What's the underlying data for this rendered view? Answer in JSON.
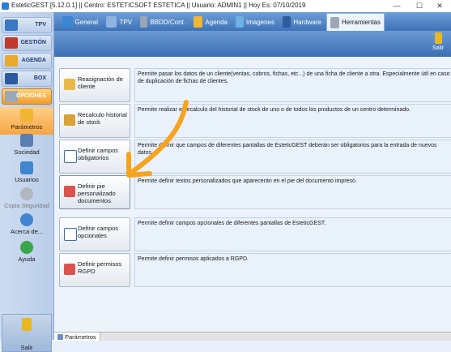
{
  "window": {
    "title": "EsteticGEST [5.12.0.1] || Centro: ESTETICSOFT ESTETICA || Usuario: ADMIN1 || Hoy Es: 07/10/2019",
    "minimize": "—",
    "maximize": "☐",
    "close": "✕"
  },
  "tabs": [
    {
      "label": "General",
      "icon": "general-icon",
      "color": "#3a86d1"
    },
    {
      "label": "TPV",
      "icon": "tpv-icon",
      "color": "#5a8fd0"
    },
    {
      "label": "BBDD/Cont.",
      "icon": "database-icon",
      "color": "#7f8b99"
    },
    {
      "label": "Agenda",
      "icon": "agenda-icon",
      "color": "#f2b632"
    },
    {
      "label": "Imagenes",
      "icon": "images-icon",
      "color": "#5aa0d8"
    },
    {
      "label": "Hardware",
      "icon": "hardware-icon",
      "color": "#3f6fb4"
    },
    {
      "label": "Herramientas",
      "icon": "tools-icon",
      "color": "#9aa8b8"
    }
  ],
  "active_tab": "Herramientas",
  "sidebar": {
    "buttons": [
      {
        "label": "TPV",
        "icon": "tpv-icon"
      },
      {
        "label": "GESTIÓN",
        "icon": "gestion-icon"
      },
      {
        "label": "AGENDA",
        "icon": "agenda-icon"
      },
      {
        "label": "BOX",
        "icon": "box-icon"
      },
      {
        "label": "OPCIONES",
        "icon": "opciones-icon"
      }
    ],
    "items": [
      {
        "label": "Parámetros",
        "icon": "parametros-icon"
      },
      {
        "label": "Sociedad",
        "icon": "sociedad-icon"
      },
      {
        "label": "Usuarios",
        "icon": "usuarios-icon"
      },
      {
        "label": "Copia Seguridad",
        "icon": "backup-icon"
      },
      {
        "label": "Acerca de...",
        "icon": "info-icon"
      },
      {
        "label": "Ayuda",
        "icon": "help-icon"
      }
    ],
    "exit_label": "Salir"
  },
  "toolbar": {
    "exit_label": "Salir"
  },
  "operations": [
    {
      "label": "Reasignación de cliente",
      "description": "Permite pasar los datos de un cliente(ventas, cobros, fichas, etc...) de una ficha de cliente a otra. Especialmente útil en caso de duplicación de fichas de clientes."
    },
    {
      "label": "Recalculo historial de stock",
      "description": "Permite realizar el recalculo del historial de stock de uno o de todos los productos de un centro determinado."
    },
    {
      "label": "Definir campos obligatorios",
      "description": "Permite definir que campos de diferentes pantallas de EsteticGEST deberán ser obligatorios para la entrada de nuevos datos."
    },
    {
      "label": "Definir pie personalizado documentos",
      "description": "Permite definir textos personalizados que aparecerán en el pie del documento impreso."
    },
    {
      "label": "Definir campos opcionales",
      "description": "Permite definir campos opcionales de diferentes pantallas de EsteticGEST."
    },
    {
      "label": "Definir permisos RGPD",
      "description": "Permite definir permisos aplicados a RGPD."
    }
  ],
  "status_tab": "Parámetros",
  "colors": {
    "accent": "#f39b2a",
    "annotation_arrow": "#f6a41e",
    "header": "#3d72b8"
  }
}
